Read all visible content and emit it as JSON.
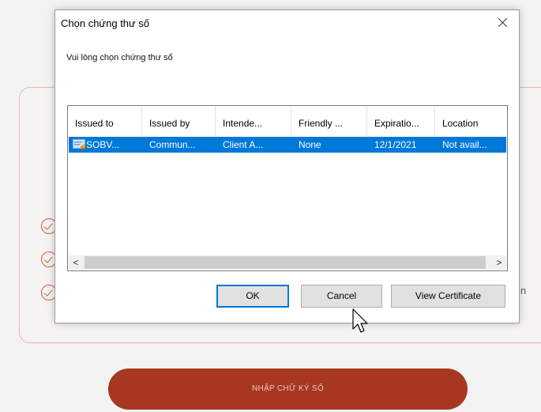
{
  "background_page": {
    "submit_button_label": "NHẬP CHỮ KÝ SỐ",
    "partial_text": "n",
    "check_icon_count": 3
  },
  "dialog": {
    "title": "Chọn chứng thư số",
    "prompt": "Vui lòng chọn chứng thư số",
    "columns": [
      "Issued to",
      "Issued by",
      "Intende...",
      "Friendly ...",
      "Expiratio...",
      "Location"
    ],
    "rows": [
      {
        "issued_to": "SOBV...",
        "issued_by": "Commun...",
        "intended": "Client A...",
        "friendly": "None",
        "expiration": "12/1/2021",
        "location": "Not avail...",
        "selected": true
      }
    ],
    "buttons": {
      "ok": "OK",
      "cancel": "Cancel",
      "view_certificate": "View Certificate"
    },
    "scroll_left_glyph": "<",
    "scroll_right_glyph": ">"
  },
  "colors": {
    "accent": "#0078d7",
    "brand_red": "#a73720",
    "check_red": "#cf5a3e"
  },
  "icons": [
    "close-icon",
    "certificate-icon",
    "check-circle-icon",
    "mouse-pointer-icon"
  ]
}
